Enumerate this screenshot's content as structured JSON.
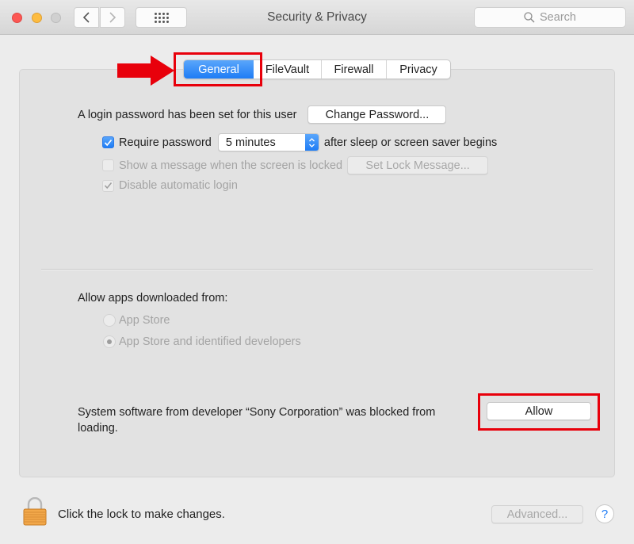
{
  "window": {
    "title": "Security & Privacy",
    "search_placeholder": "Search"
  },
  "tabs": [
    {
      "label": "General",
      "active": true
    },
    {
      "label": "FileVault",
      "active": false
    },
    {
      "label": "Firewall",
      "active": false
    },
    {
      "label": "Privacy",
      "active": false
    }
  ],
  "general": {
    "login_password_text": "A login password has been set for this user",
    "change_password_label": "Change Password...",
    "require_password": {
      "checked": true,
      "label": "Require password",
      "interval": "5 minutes",
      "suffix": "after sleep or screen saver begins"
    },
    "show_message": {
      "checked": false,
      "enabled": false,
      "label": "Show a message when the screen is locked",
      "button_label": "Set Lock Message..."
    },
    "disable_auto_login": {
      "checked": true,
      "enabled": false,
      "label": "Disable automatic login"
    },
    "allow_apps_heading": "Allow apps downloaded from:",
    "allow_apps_options": [
      {
        "label": "App Store",
        "selected": false
      },
      {
        "label": "App Store and identified developers",
        "selected": true
      }
    ],
    "blocked_message": "System software from developer “Sony Corporation” was blocked from loading.",
    "allow_button_label": "Allow"
  },
  "footer": {
    "lock_text": "Click the lock to make changes.",
    "advanced_label": "Advanced...",
    "help_label": "?"
  },
  "annotations": {
    "highlight_color": "#e8000b"
  }
}
